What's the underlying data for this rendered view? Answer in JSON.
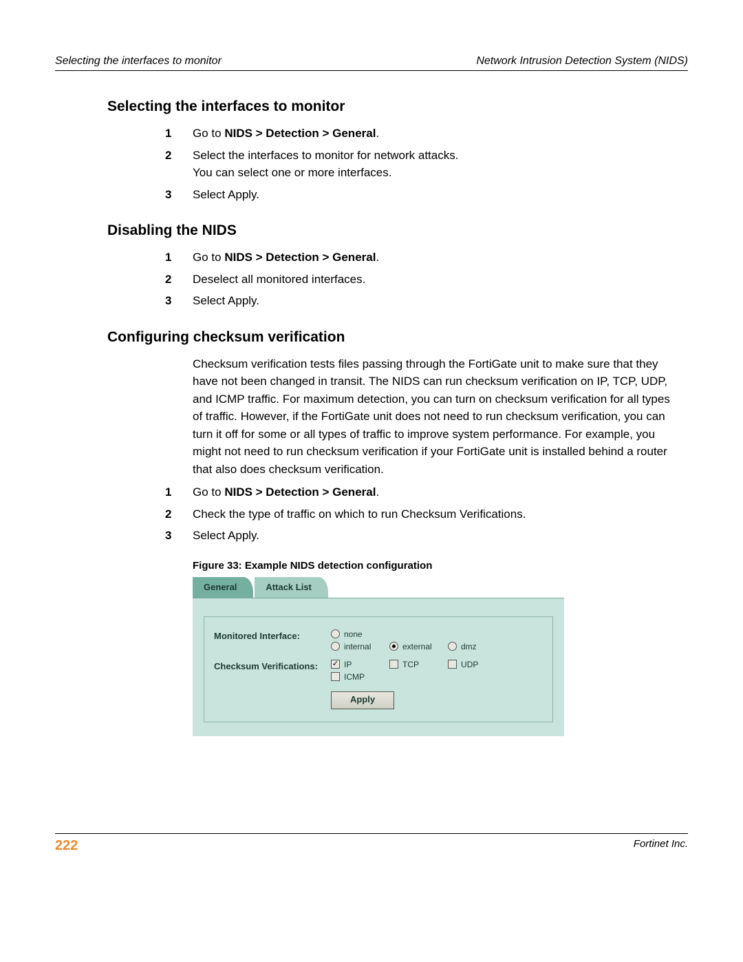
{
  "header": {
    "left": "Selecting the interfaces to monitor",
    "right": "Network Intrusion Detection System (NIDS)"
  },
  "sections": [
    {
      "title": "Selecting the interfaces to monitor",
      "steps": [
        {
          "num": "1",
          "prefix": "Go to ",
          "bold": "NIDS > Detection > General",
          "suffix": "."
        },
        {
          "num": "2",
          "text": "Select the interfaces to monitor for network attacks.",
          "text2": "You can select one or more interfaces."
        },
        {
          "num": "3",
          "text": "Select Apply."
        }
      ]
    },
    {
      "title": "Disabling the NIDS",
      "steps": [
        {
          "num": "1",
          "prefix": "Go to ",
          "bold": "NIDS > Detection > General",
          "suffix": "."
        },
        {
          "num": "2",
          "text": "Deselect all monitored interfaces."
        },
        {
          "num": "3",
          "text": "Select Apply."
        }
      ]
    },
    {
      "title": "Configuring checksum verification",
      "para": "Checksum verification tests files passing through the FortiGate unit to make sure that they have not been changed in transit. The NIDS can run checksum verification on IP, TCP, UDP, and ICMP traffic. For maximum detection, you can turn on checksum verification for all types of traffic. However, if the FortiGate unit does not need to run checksum verification, you can turn it off for some or all types of traffic to improve system performance. For example, you might not need to run checksum verification if your FortiGate unit is installed behind a router that also does checksum verification.",
      "steps": [
        {
          "num": "1",
          "prefix": "Go to ",
          "bold": "NIDS > Detection > General",
          "suffix": "."
        },
        {
          "num": "2",
          "text": "Check the type of traffic on which to run Checksum Verifications."
        },
        {
          "num": "3",
          "text": "Select Apply."
        }
      ],
      "figure_caption": "Figure 33: Example NIDS detection configuration"
    }
  ],
  "figure_ui": {
    "tabs": {
      "active": "General",
      "inactive": "Attack List"
    },
    "labels": {
      "monitored_interface": "Monitored Interface:",
      "checksum_verifications": "Checksum Verifications:"
    },
    "monitored_interface": {
      "none": {
        "label": "none",
        "selected": false
      },
      "internal": {
        "label": "internal",
        "selected": false
      },
      "external": {
        "label": "external",
        "selected": true
      },
      "dmz": {
        "label": "dmz",
        "selected": false
      }
    },
    "checksum": {
      "ip": {
        "label": "IP",
        "checked": true
      },
      "tcp": {
        "label": "TCP",
        "checked": false
      },
      "udp": {
        "label": "UDP",
        "checked": false
      },
      "icmp": {
        "label": "ICMP",
        "checked": false
      }
    },
    "apply_label": "Apply"
  },
  "footer": {
    "page": "222",
    "right": "Fortinet Inc."
  }
}
